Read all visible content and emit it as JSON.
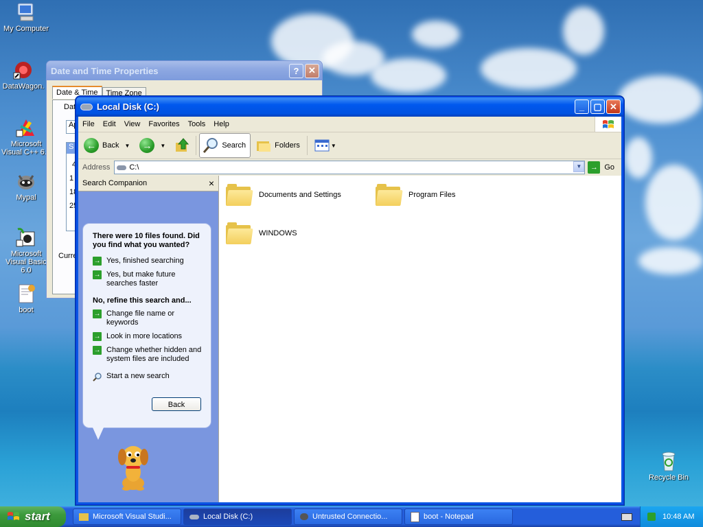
{
  "desktop": {
    "icons": [
      {
        "label": "My Computer"
      },
      {
        "label": "DataWagon."
      },
      {
        "label": "Microsoft Visual C++ 6.0"
      },
      {
        "label": "Mypal"
      },
      {
        "label": "Microsoft Visual Basic 6.0"
      },
      {
        "label": "boot"
      },
      {
        "label": "Recycle Bin"
      }
    ]
  },
  "datetime_window": {
    "title": "Date and Time Properties",
    "tabs": [
      "Date & Time",
      "Time Zone"
    ],
    "fragments": {
      "dat": "Dat",
      "ap": "Ap",
      "s": "S",
      "n4": "4",
      "n1": "1",
      "n18": "18",
      "n25": "25",
      "curr": "Curre"
    }
  },
  "explorer": {
    "title": "Local Disk (C:)",
    "menu": [
      "File",
      "Edit",
      "View",
      "Favorites",
      "Tools",
      "Help"
    ],
    "toolbar": {
      "back": "Back",
      "search": "Search",
      "folders": "Folders"
    },
    "address": {
      "label": "Address",
      "value": "C:\\",
      "go": "Go"
    },
    "search_companion": {
      "header": "Search Companion",
      "close": "×",
      "found_text": "There were 10 files found. Did you find what you wanted?",
      "options": [
        "Yes, finished searching",
        "Yes, but make future searches faster"
      ],
      "refine_heading": "No, refine this search and...",
      "refine_options": [
        "Change file name or keywords",
        "Look in more locations",
        "Change whether hidden and system files are included"
      ],
      "new_search": "Start a new search",
      "back_button": "Back"
    },
    "items": [
      {
        "name": "Documents and Settings"
      },
      {
        "name": "Program Files"
      },
      {
        "name": "WINDOWS"
      }
    ]
  },
  "taskbar": {
    "start": "start",
    "tasks": [
      {
        "label": "Microsoft Visual Studi..."
      },
      {
        "label": "Local Disk (C:)"
      },
      {
        "label": "Untrusted Connectio..."
      },
      {
        "label": "boot - Notepad"
      }
    ],
    "clock": "10:48 AM"
  },
  "colors": {
    "taskbar": "#245edb",
    "start_green": "#3c9a3c",
    "sidebar": "#7a96df"
  }
}
